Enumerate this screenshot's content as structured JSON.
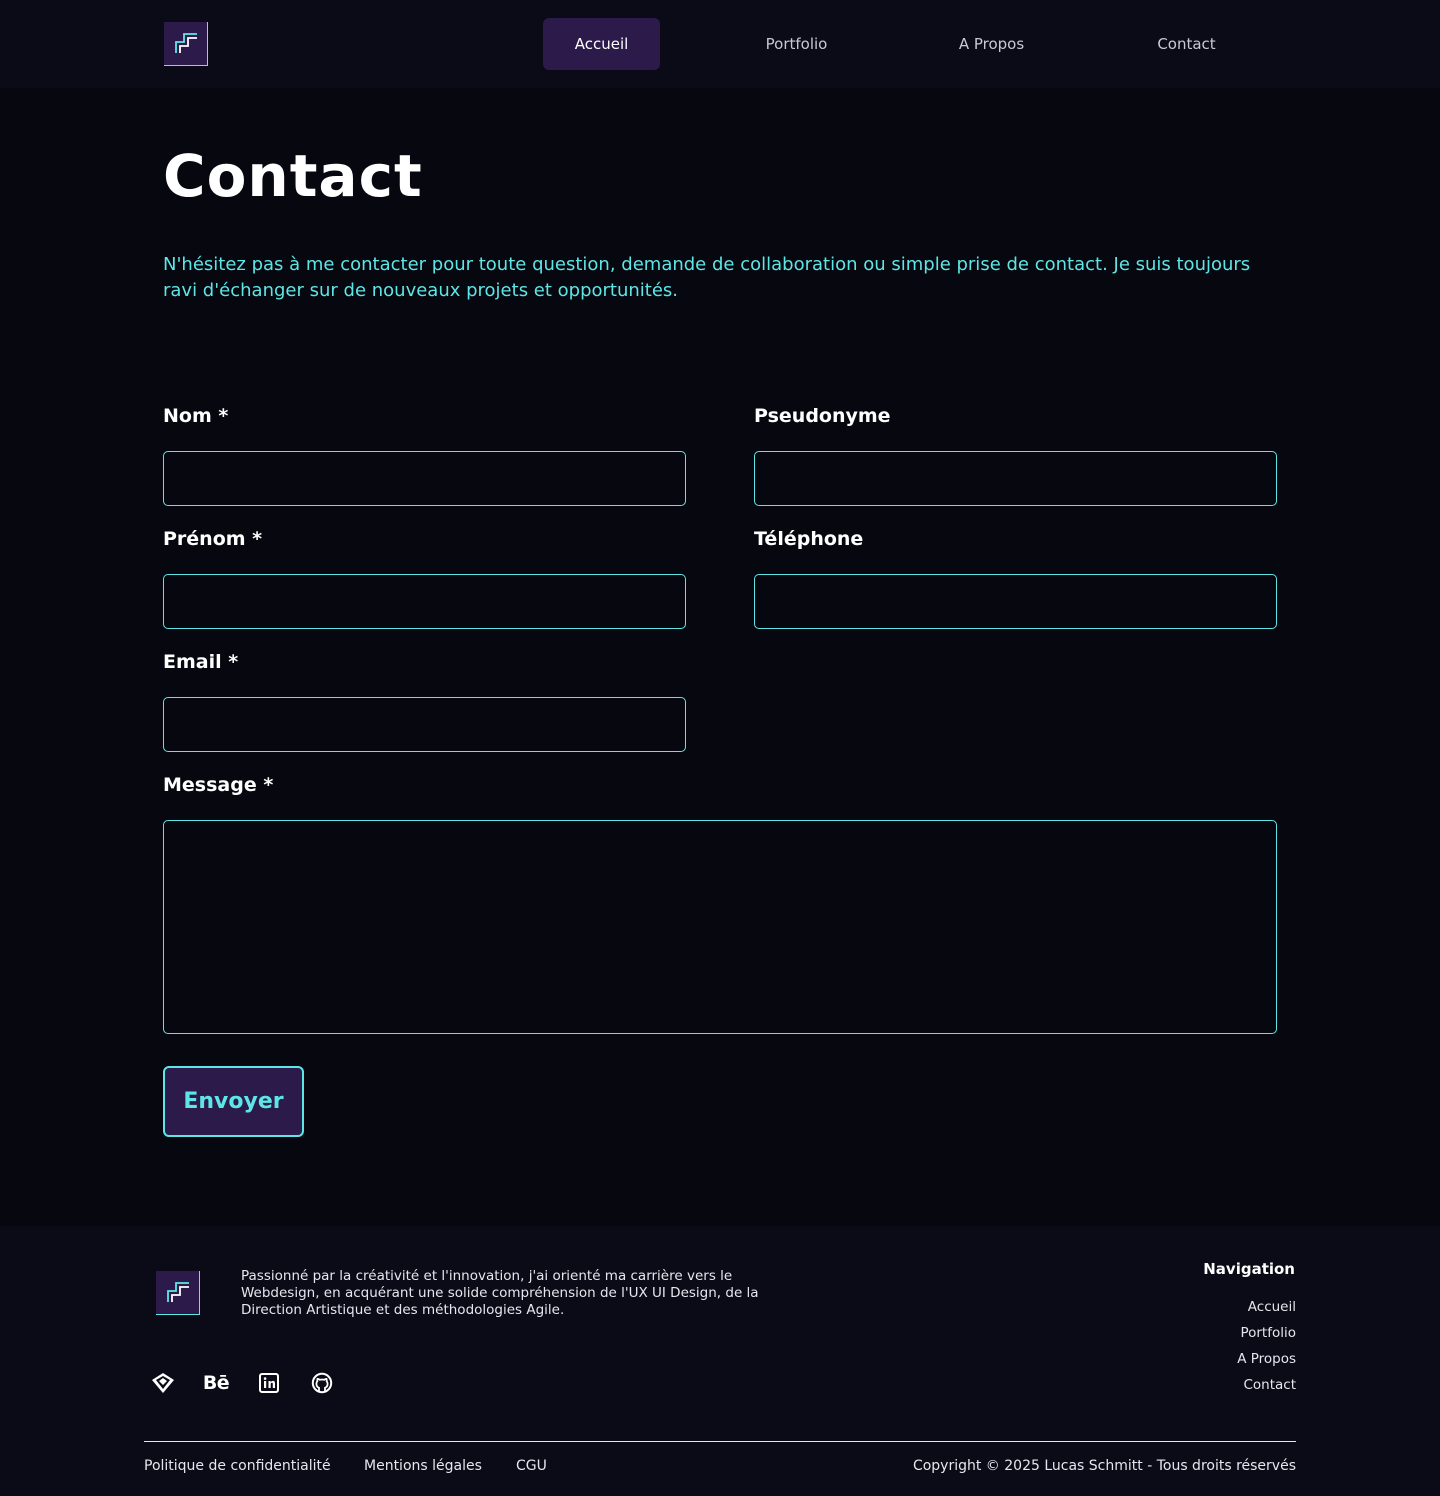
{
  "header": {
    "nav": [
      {
        "label": "Accueil",
        "active": true
      },
      {
        "label": "Portfolio",
        "active": false
      },
      {
        "label": "A Propos",
        "active": false
      },
      {
        "label": "Contact",
        "active": false
      }
    ]
  },
  "main": {
    "title": "Contact",
    "intro": "N'hésitez pas à me contacter pour toute question, demande de collaboration ou simple prise de contact. Je suis toujours ravi d'échanger sur de nouveaux projets et opportunités.",
    "form": {
      "nom_label": "Nom *",
      "pseudo_label": "Pseudonyme",
      "prenom_label": "Prénom *",
      "telephone_label": "Téléphone",
      "email_label": "Email *",
      "message_label": "Message *",
      "nom_value": "",
      "pseudo_value": "",
      "prenom_value": "",
      "telephone_value": "",
      "email_value": "",
      "message_value": "",
      "submit_label": "Envoyer"
    }
  },
  "footer": {
    "description": "Passionné par la créativité et l'innovation, j'ai orienté ma carrière vers le Webdesign, en acquérant une solide compréhension de l'UX UI Design, de la Direction Artistique et des méthodologies Agile.",
    "social": [
      "dribbble-icon",
      "behance-icon",
      "linkedin-icon",
      "github-icon"
    ],
    "behance_text": "Bē",
    "nav_title": "Navigation",
    "nav": [
      "Accueil",
      "Portfolio",
      "A Propos",
      "Contact"
    ],
    "legal": [
      "Politique de confidentialité",
      "Mentions légales",
      "CGU"
    ],
    "copyright": "Copyright © 2025 Lucas Schmitt - Tous droits réservés"
  },
  "colors": {
    "background": "#07070f",
    "header_bg": "#0b0b17",
    "accent_cyan": "#5ee6e6",
    "accent_purple": "#2b1a4a",
    "text": "#ffffff"
  }
}
